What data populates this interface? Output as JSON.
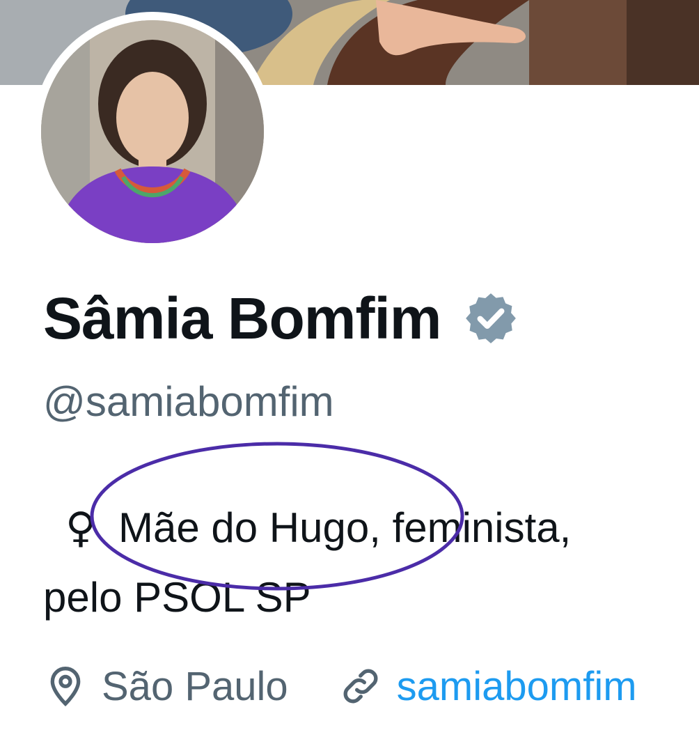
{
  "profile": {
    "display_name": "Sâmia Bomfim",
    "handle": "@samiabomfim",
    "bio_line1_prefix": "♀",
    "bio_line1_text": "Mãe do Hugo, feminista,",
    "bio_line2": "pelo PSOL SP",
    "location": "São Paulo",
    "website": "samiabomfim"
  },
  "icons": {
    "verified": "verified-badge-icon",
    "location": "location-pin-icon",
    "link": "link-icon"
  },
  "colors": {
    "name": "#0f1419",
    "secondary": "#536471",
    "link": "#1d9bf0",
    "verified_badge": "#829aab",
    "annotation_circle": "#4b2ca8"
  }
}
